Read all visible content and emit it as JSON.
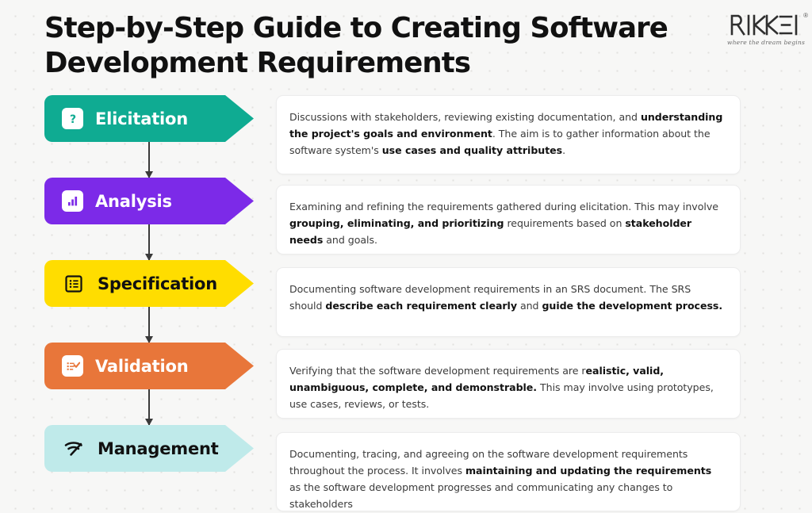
{
  "header": {
    "title": "Step-by-Step Guide to Creating Software\nDevelopment Requirements",
    "logo": {
      "name": "RIKKEI",
      "registered": "®",
      "tagline": "where the dream begins"
    }
  },
  "colors": {
    "background": "#f7f7f6",
    "step1": "#0fab92",
    "step2": "#7c2ae8",
    "step3": "#ffdd00",
    "step4": "#e8763a",
    "step5": "#bfeaea",
    "card_background": "#ffffff",
    "card_border": "#ececec",
    "arrow": "#3a3a3a",
    "title_text": "#111111",
    "body_text": "#3b3b3b"
  },
  "steps": [
    {
      "label": "Elicitation",
      "icon": "question-mark-icon",
      "color": "#0fab92",
      "label_color": "#ffffff",
      "icon_color": "#0fab92",
      "description_runs": [
        {
          "text": "Discussions with stakeholders, reviewing existing documentation, and ",
          "bold": false
        },
        {
          "text": "understanding the project's goals and environment",
          "bold": true
        },
        {
          "text": ". The aim is to gather information about the software system's ",
          "bold": false
        },
        {
          "text": "use cases and quality attributes",
          "bold": true
        },
        {
          "text": ".",
          "bold": false
        }
      ]
    },
    {
      "label": "Analysis",
      "icon": "bar-chart-icon",
      "color": "#7c2ae8",
      "label_color": "#ffffff",
      "icon_color": "#7c2ae8",
      "description_runs": [
        {
          "text": "Examining and refining the requirements gathered during elicitation. This may involve ",
          "bold": false
        },
        {
          "text": "grouping, eliminating, and prioritizing",
          "bold": true
        },
        {
          "text": " requirements based on ",
          "bold": false
        },
        {
          "text": "stakeholder needs",
          "bold": true
        },
        {
          "text": " and goals.",
          "bold": false
        }
      ]
    },
    {
      "label": "Specification",
      "icon": "document-list-icon",
      "color": "#ffdd00",
      "label_color": "#111111",
      "icon_color": "#111111",
      "description_runs": [
        {
          "text": "Documenting software development requirements in an SRS document. The SRS should ",
          "bold": false
        },
        {
          "text": "describe each requirement clearly",
          "bold": true
        },
        {
          "text": " and ",
          "bold": false
        },
        {
          "text": "guide the development process.",
          "bold": true
        }
      ]
    },
    {
      "label": "Validation",
      "icon": "checklist-icon",
      "color": "#e8763a",
      "label_color": "#ffffff",
      "icon_color": "#e8763a",
      "description_runs": [
        {
          "text": "Verifying that the software development requirements are r",
          "bold": false
        },
        {
          "text": "ealistic, valid, unambiguous, complete, and demonstrable.",
          "bold": true
        },
        {
          "text": " This may involve using prototypes, use cases, reviews, or tests.",
          "bold": false
        }
      ]
    },
    {
      "label": "Management",
      "icon": "broadcast-signal-icon",
      "color": "#bfeaea",
      "label_color": "#111111",
      "icon_color": "#111111",
      "description_runs": [
        {
          "text": "Documenting, tracing, and agreeing on the software development requirements throughout the process. It involves ",
          "bold": false
        },
        {
          "text": "maintaining and updating the requirements",
          "bold": true
        },
        {
          "text": " as the software development progresses and communicating any changes to stakeholders",
          "bold": false
        }
      ]
    }
  ]
}
